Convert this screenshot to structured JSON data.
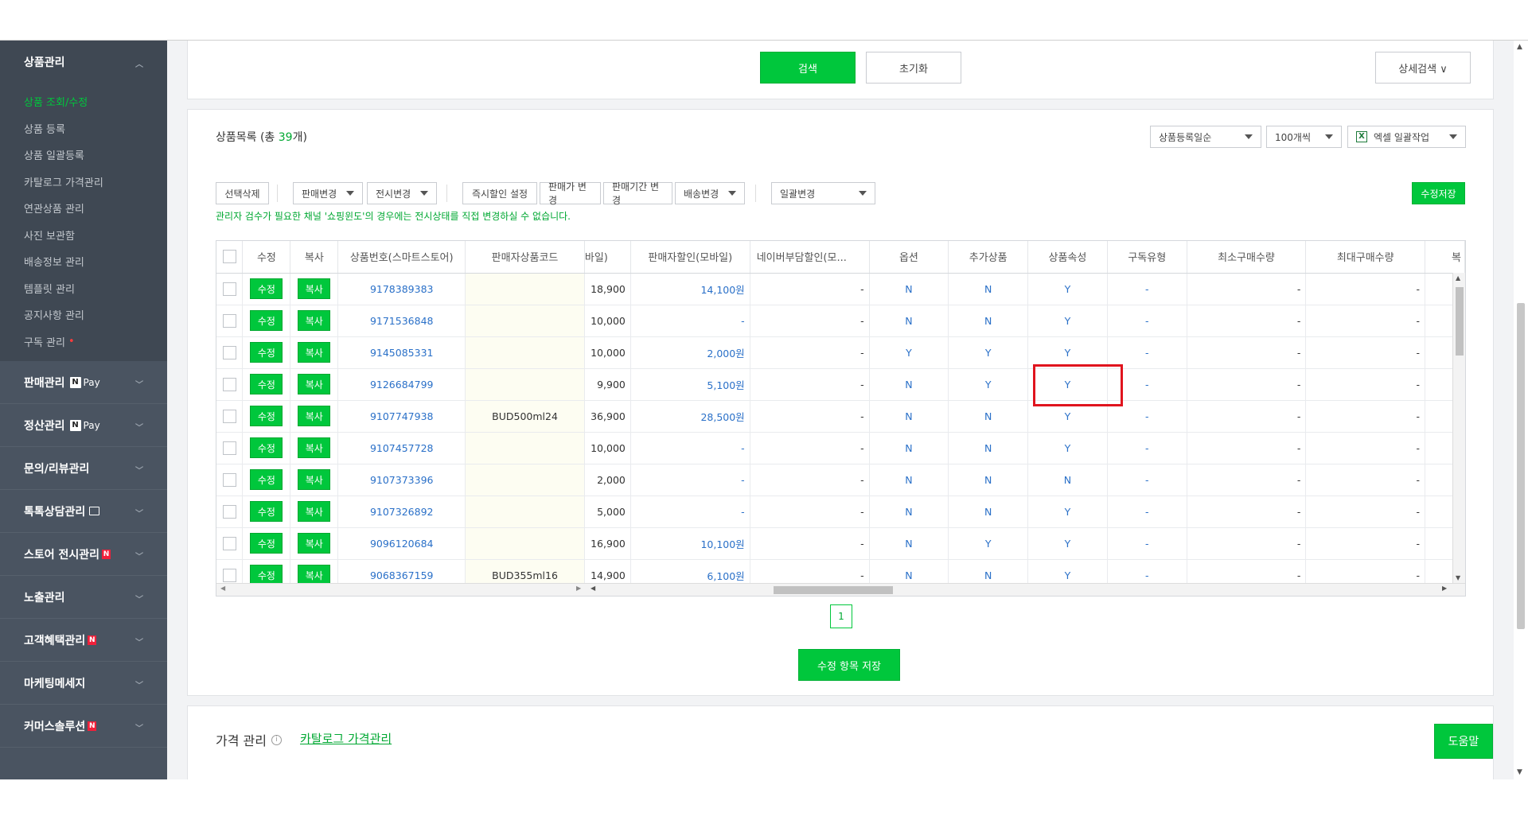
{
  "sidebar": {
    "product": {
      "title": "상품관리",
      "items": [
        "상품 조회/수정",
        "상품 등록",
        "상품 일괄등록",
        "카탈로그 가격관리",
        "연관상품 관리",
        "사진 보관함",
        "배송정보 관리",
        "템플릿 관리",
        "공지사항 관리",
        "구독 관리"
      ]
    },
    "menus": [
      {
        "label": "판매관리",
        "badge": "N",
        "pay": "Pay"
      },
      {
        "label": "정산관리",
        "badge": "N",
        "pay": "Pay"
      },
      {
        "label": "문의/리뷰관리"
      },
      {
        "label": "톡톡상담관리",
        "icon": "chat-icon"
      },
      {
        "label": "스토어 전시관리",
        "new": "N"
      },
      {
        "label": "노출관리"
      },
      {
        "label": "고객혜택관리",
        "new": "N"
      },
      {
        "label": "마케팅메세지"
      },
      {
        "label": "커머스솔루션",
        "new": "N"
      }
    ]
  },
  "search": {
    "search_label": "검색",
    "reset_label": "초기화",
    "detail_label": "상세검색 ∨"
  },
  "list": {
    "title_prefix": "상품목록 (총 ",
    "count": "39",
    "title_suffix": "개)",
    "sort": "상품등록일순",
    "per_page": "100개씩",
    "excel": "엑셀 일괄작업",
    "actions": {
      "delete": "선택삭제",
      "sale_change": "판매변경",
      "display_change": "전시변경",
      "instant_discount": "즉시할인 설정",
      "price_change": "판매가 변경",
      "period_change": "판매기간 변경",
      "shipping_change": "배송변경",
      "bulk_change": "일괄변경",
      "save_edits": "수정저장"
    },
    "notice": "관리자 검수가 필요한 채널 '쇼핑윈도'의 경우에는 전시상태를 직접 변경하실 수 없습니다.",
    "columns": [
      "",
      "수정",
      "복사",
      "상품번호(스마트스토어)",
      "판매자상품코드",
      "바일)",
      "판매자할인(모바일)",
      "네이버부담할인(모...",
      "옵션",
      "추가상품",
      "상품속성",
      "구독유형",
      "최소구매수량",
      "최대구매수량",
      "복"
    ],
    "edit_label": "수정",
    "copy_label": "복사",
    "rows": [
      {
        "id": "9178389383",
        "code": "",
        "price": "18,900",
        "disc": "14,100원",
        "naver": "-",
        "opt": "N",
        "add": "N",
        "attr": "Y",
        "sub": "-",
        "min": "-",
        "max": "-"
      },
      {
        "id": "9171536848",
        "code": "",
        "price": "10,000",
        "disc": "-",
        "naver": "-",
        "opt": "N",
        "add": "N",
        "attr": "Y",
        "sub": "-",
        "min": "-",
        "max": "-"
      },
      {
        "id": "9145085331",
        "code": "",
        "price": "10,000",
        "disc": "2,000원",
        "naver": "-",
        "opt": "Y",
        "add": "Y",
        "attr": "Y",
        "sub": "-",
        "min": "-",
        "max": "-"
      },
      {
        "id": "9126684799",
        "code": "",
        "price": "9,900",
        "disc": "5,100원",
        "naver": "-",
        "opt": "N",
        "add": "Y",
        "attr": "Y",
        "sub": "-",
        "min": "-",
        "max": "-"
      },
      {
        "id": "9107747938",
        "code": "BUD500ml24",
        "price": "36,900",
        "disc": "28,500원",
        "naver": "-",
        "opt": "N",
        "add": "N",
        "attr": "Y",
        "sub": "-",
        "min": "-",
        "max": "-"
      },
      {
        "id": "9107457728",
        "code": "",
        "price": "10,000",
        "disc": "-",
        "naver": "-",
        "opt": "N",
        "add": "N",
        "attr": "Y",
        "sub": "-",
        "min": "-",
        "max": "-"
      },
      {
        "id": "9107373396",
        "code": "",
        "price": "2,000",
        "disc": "-",
        "naver": "-",
        "opt": "N",
        "add": "N",
        "attr": "N",
        "sub": "-",
        "min": "-",
        "max": "-"
      },
      {
        "id": "9107326892",
        "code": "",
        "price": "5,000",
        "disc": "-",
        "naver": "-",
        "opt": "N",
        "add": "N",
        "attr": "Y",
        "sub": "-",
        "min": "-",
        "max": "-"
      },
      {
        "id": "9096120684",
        "code": "",
        "price": "16,900",
        "disc": "10,100원",
        "naver": "-",
        "opt": "N",
        "add": "Y",
        "attr": "Y",
        "sub": "-",
        "min": "-",
        "max": "-"
      },
      {
        "id": "9068367159",
        "code": "BUD355ml16",
        "price": "14,900",
        "disc": "6,100원",
        "naver": "-",
        "opt": "N",
        "add": "N",
        "attr": "Y",
        "sub": "-",
        "min": "-",
        "max": "-"
      }
    ],
    "page": "1",
    "save_items": "수정 항목 저장"
  },
  "price_mgmt": {
    "title": "가격 관리",
    "link": "카탈로그 가격관리",
    "help": "도움말"
  }
}
